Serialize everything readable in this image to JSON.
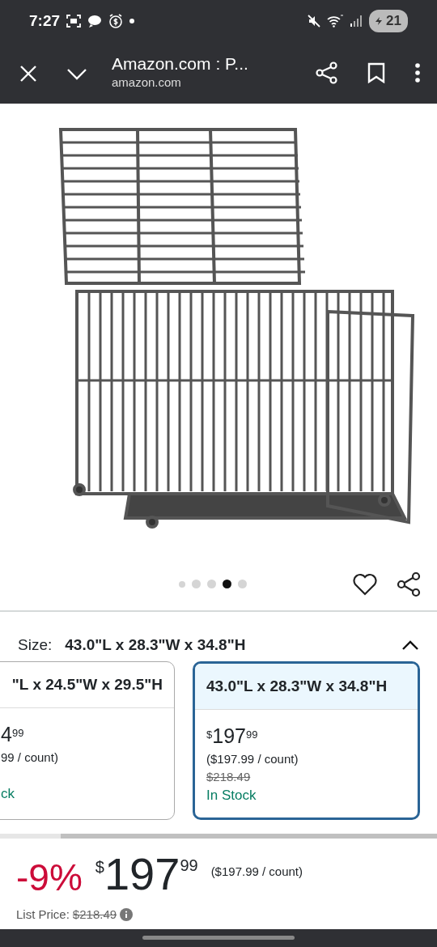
{
  "status_bar": {
    "time": "7:27",
    "battery": "21"
  },
  "toolbar": {
    "title": "Amazon.com : P...",
    "url": "amazon.com"
  },
  "gallery": {
    "dots": [
      {
        "selected": false
      },
      {
        "selected": false
      },
      {
        "selected": false
      },
      {
        "selected": true
      },
      {
        "selected": false
      }
    ]
  },
  "size": {
    "label": "Size:",
    "value": "43.0\"L x 28.3\"W x 34.8\"H",
    "expanded": true
  },
  "options": [
    {
      "dimensions": "\"L x 24.5\"W x 29.5\"H",
      "price_whole": "4",
      "price_fraction": "99",
      "unit_price": "99 / count)",
      "availability": "ck",
      "selected": false
    },
    {
      "dimensions": "43.0\"L x 28.3\"W x 34.8\"H",
      "price_symbol": "$",
      "price_whole": "197",
      "price_fraction": "99",
      "unit_price": "($197.99 / count)",
      "list_price": "$218.49",
      "availability": "In Stock",
      "selected": true
    }
  ],
  "price": {
    "discount": "-9%",
    "symbol": "$",
    "whole": "197",
    "fraction": "99",
    "unit_price": "($197.99 / count)",
    "list_label": "List Price:",
    "list_price": "$218.49"
  }
}
